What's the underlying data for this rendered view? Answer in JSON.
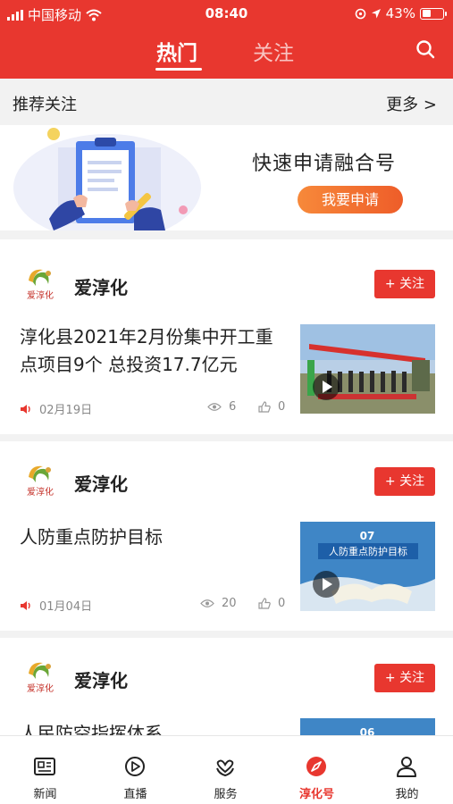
{
  "status_bar": {
    "carrier": "中国移动",
    "time": "08:40",
    "battery": "43%",
    "battery_level": 0.43
  },
  "header": {
    "tabs": [
      {
        "label": "热门",
        "active": true
      },
      {
        "label": "关注",
        "active": false
      }
    ]
  },
  "recommend": {
    "title": "推荐关注",
    "more": "更多 >"
  },
  "banner": {
    "title": "快速申请融合号",
    "button": "我要申请"
  },
  "cards": [
    {
      "author": "爱淳化",
      "logo_text": "爱淳化",
      "follow": "+ 关注",
      "headline": "淳化县2021年2月份集中开工重点项目9个 总投资17.7亿元",
      "date": "02月19日",
      "views": "6",
      "likes": "0"
    },
    {
      "author": "爱淳化",
      "logo_text": "爱淳化",
      "follow": "+ 关注",
      "headline": "人防重点防护目标",
      "date": "01月04日",
      "views": "20",
      "likes": "0",
      "thumb_number": "07",
      "thumb_title": "人防重点防护目标"
    },
    {
      "author": "爱淳化",
      "logo_text": "爱淳化",
      "follow": "+ 关注",
      "headline": "人民防空指挥体系",
      "thumb_number": "06"
    }
  ],
  "bottom_nav": [
    {
      "label": "新闻",
      "icon": "news-icon",
      "active": false
    },
    {
      "label": "直播",
      "icon": "live-icon",
      "active": false
    },
    {
      "label": "服务",
      "icon": "service-icon",
      "active": false
    },
    {
      "label": "淳化号",
      "icon": "compass-icon",
      "active": true
    },
    {
      "label": "我的",
      "icon": "user-icon",
      "active": false
    }
  ],
  "colors": {
    "brand_red": "#e8372f",
    "orange": "#ee5d29"
  }
}
